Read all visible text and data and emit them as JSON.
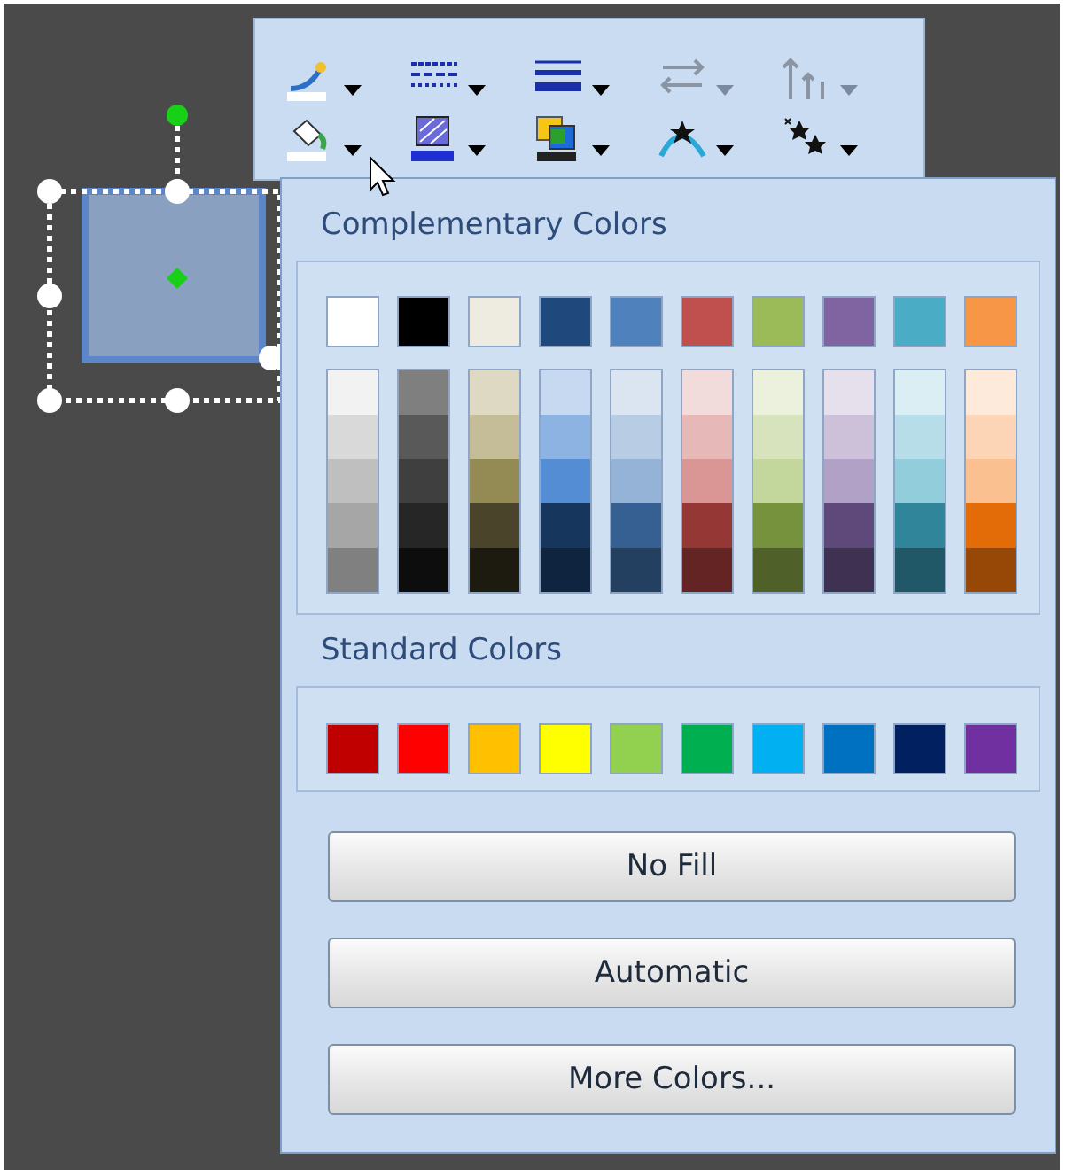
{
  "toolbar": {
    "buttons": [
      {
        "kind": "pen",
        "disabled": false
      },
      {
        "kind": "dash",
        "disabled": false
      },
      {
        "kind": "weight",
        "disabled": false
      },
      {
        "kind": "ends",
        "disabled": true
      },
      {
        "kind": "arrows",
        "disabled": true
      },
      {
        "kind": "bucket",
        "disabled": false
      },
      {
        "kind": "pattern",
        "disabled": false
      },
      {
        "kind": "shadow",
        "disabled": false
      },
      {
        "kind": "curve",
        "disabled": false
      },
      {
        "kind": "stars",
        "disabled": false
      }
    ]
  },
  "color_menu": {
    "theme_title": "Complementary Colors",
    "theme_colors": [
      {
        "color": "#ffffff",
        "shades": [
          {
            "color": "#f2f2f2"
          },
          {
            "color": "#d9d9d9"
          },
          {
            "color": "#bfbfbf"
          },
          {
            "color": "#a6a6a6"
          },
          {
            "color": "#808080"
          }
        ]
      },
      {
        "color": "#000000",
        "shades": [
          {
            "color": "#7f7f7f"
          },
          {
            "color": "#595959"
          },
          {
            "color": "#3f3f3f"
          },
          {
            "color": "#262626"
          },
          {
            "color": "#0d0d0d"
          }
        ]
      },
      {
        "color": "#eeece1",
        "shades": [
          {
            "color": "#ddd9c3"
          },
          {
            "color": "#c4bd97"
          },
          {
            "color": "#948a54"
          },
          {
            "color": "#4a452a"
          },
          {
            "color": "#1d1b10"
          }
        ]
      },
      {
        "color": "#1f497d",
        "shades": [
          {
            "color": "#c6d9f1"
          },
          {
            "color": "#8db3e2"
          },
          {
            "color": "#548dd4"
          },
          {
            "color": "#17365d"
          },
          {
            "color": "#0f243e"
          }
        ]
      },
      {
        "color": "#4f81bd",
        "shades": [
          {
            "color": "#dbe5f1"
          },
          {
            "color": "#b8cce4"
          },
          {
            "color": "#95b3d7"
          },
          {
            "color": "#366092"
          },
          {
            "color": "#244061"
          }
        ]
      },
      {
        "color": "#c0504d",
        "shades": [
          {
            "color": "#f2dcdb"
          },
          {
            "color": "#e6b9b8"
          },
          {
            "color": "#d99694"
          },
          {
            "color": "#953734"
          },
          {
            "color": "#632423"
          }
        ]
      },
      {
        "color": "#9bbb59",
        "shades": [
          {
            "color": "#ebf1dd"
          },
          {
            "color": "#d7e3bc"
          },
          {
            "color": "#c3d69b"
          },
          {
            "color": "#76923c"
          },
          {
            "color": "#4f6128"
          }
        ]
      },
      {
        "color": "#8064a2",
        "shades": [
          {
            "color": "#e5e0ec"
          },
          {
            "color": "#ccc1d9"
          },
          {
            "color": "#b2a1c7"
          },
          {
            "color": "#5f497a"
          },
          {
            "color": "#3f3151"
          }
        ]
      },
      {
        "color": "#4bacc6",
        "shades": [
          {
            "color": "#dbeef3"
          },
          {
            "color": "#b7dde8"
          },
          {
            "color": "#92cddc"
          },
          {
            "color": "#31859b"
          },
          {
            "color": "#205867"
          }
        ]
      },
      {
        "color": "#f79646",
        "shades": [
          {
            "color": "#fdeada"
          },
          {
            "color": "#fbd5b5"
          },
          {
            "color": "#fac08f"
          },
          {
            "color": "#e36c09"
          },
          {
            "color": "#974806"
          }
        ]
      }
    ],
    "standard_title": "Standard Colors",
    "standard_colors": [
      {
        "color": "#c00000"
      },
      {
        "color": "#ff0000"
      },
      {
        "color": "#ffc000"
      },
      {
        "color": "#ffff00"
      },
      {
        "color": "#92d050"
      },
      {
        "color": "#00b050"
      },
      {
        "color": "#00b0f0"
      },
      {
        "color": "#0070c0"
      },
      {
        "color": "#002060"
      },
      {
        "color": "#7030a0"
      }
    ],
    "buttons": [
      "No Fill",
      "Automatic",
      "More Colors..."
    ]
  }
}
